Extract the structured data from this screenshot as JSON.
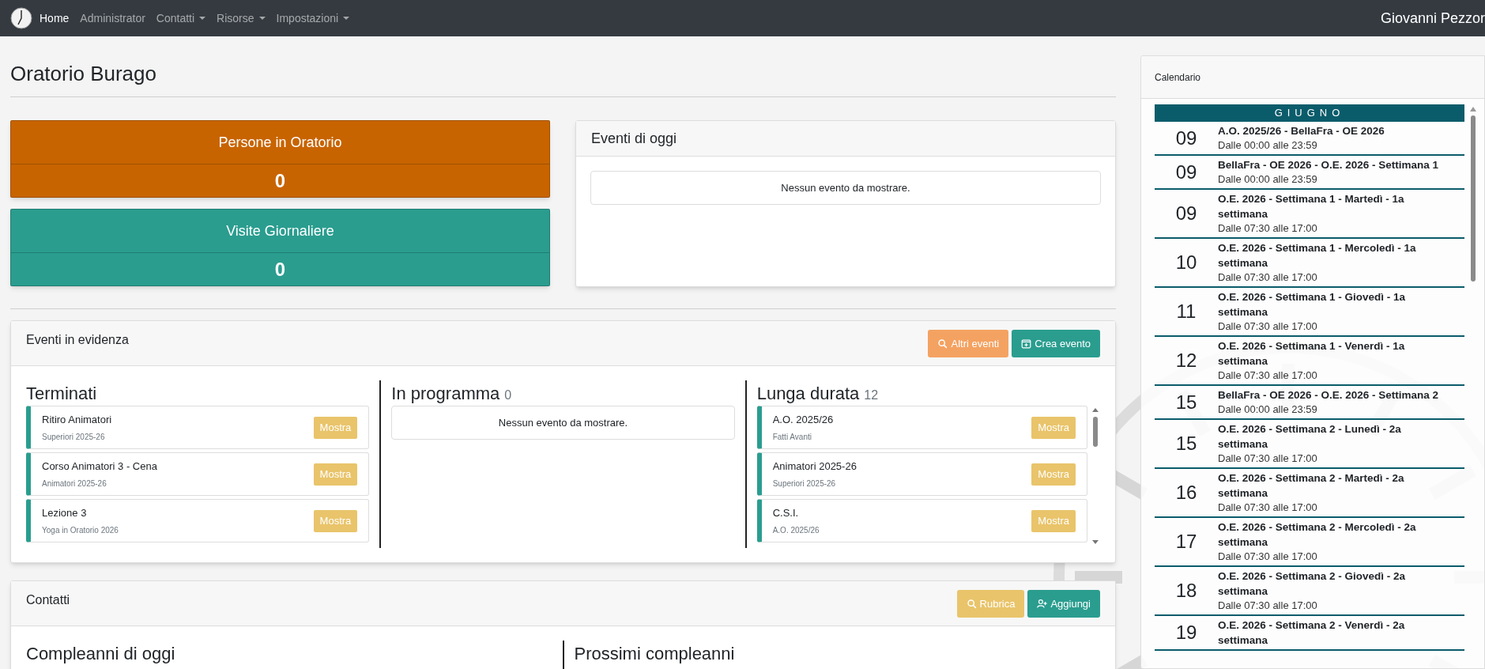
{
  "navbar": {
    "items": [
      {
        "label": "Home",
        "selected": true,
        "dropdown": false
      },
      {
        "label": "Administrator",
        "selected": false,
        "dropdown": false
      },
      {
        "label": "Contatti",
        "selected": false,
        "dropdown": true
      },
      {
        "label": "Risorse",
        "selected": false,
        "dropdown": true
      },
      {
        "label": "Impostazioni",
        "selected": false,
        "dropdown": true
      }
    ],
    "user": "Giovanni Pezzor"
  },
  "page_title": "Oratorio Burago",
  "stats": [
    {
      "label": "Persone in Oratorio",
      "value": "0",
      "color": "#c86400"
    },
    {
      "label": "Visite Giornaliere",
      "value": "0",
      "color": "#2a9d8f"
    }
  ],
  "today_events": {
    "title": "Eventi di oggi",
    "empty_message": "Nessun evento da mostrare."
  },
  "featured": {
    "title": "Eventi in evidenza",
    "buttons": [
      {
        "label": "Altri eventi",
        "kind": "search"
      },
      {
        "label": "Crea evento",
        "kind": "create"
      }
    ],
    "columns": [
      {
        "title": "Terminati",
        "items": [
          {
            "title": "Ritiro Animatori",
            "subtitle": "Superiori 2025-26",
            "button": "Mostra"
          },
          {
            "title": "Corso Animatori 3 - Cena",
            "subtitle": "Animatori 2025-26",
            "button": "Mostra"
          },
          {
            "title": "Lezione 3",
            "subtitle": "Yoga in Oratorio 2026",
            "button": "Mostra"
          }
        ]
      },
      {
        "title": "In programma",
        "count": "0",
        "empty_message": "Nessun evento da mostrare."
      },
      {
        "title": "Lunga durata",
        "count": "12",
        "scrollable": true,
        "items": [
          {
            "title": "A.O. 2025/26",
            "subtitle": "Fatti Avanti",
            "button": "Mostra"
          },
          {
            "title": "Animatori 2025-26",
            "subtitle": "Superiori 2025-26",
            "button": "Mostra"
          },
          {
            "title": "C.S.I.",
            "subtitle": "A.O. 2025/26",
            "button": "Mostra"
          }
        ]
      }
    ]
  },
  "contacts": {
    "title": "Contatti",
    "buttons": [
      {
        "label": "Rubrica",
        "kind": "search"
      },
      {
        "label": "Aggiungi",
        "kind": "add-person"
      }
    ],
    "columns": [
      {
        "title": "Compleanni di oggi"
      },
      {
        "title": "Prossimi compleanni"
      }
    ]
  },
  "calendar": {
    "title": "Calendario",
    "month": "GIUGNO",
    "entries": [
      {
        "day": "09",
        "title": "A.O. 2025/26 - BellaFra - OE 2026",
        "time": "Dalle 00:00 alle 23:59"
      },
      {
        "day": "09",
        "title": "BellaFra - OE 2026 - O.E. 2026 - Settimana 1",
        "time": "Dalle 00:00 alle 23:59"
      },
      {
        "day": "09",
        "title": "O.E. 2026 - Settimana 1 - Martedì - 1a settimana",
        "time": "Dalle 07:30 alle 17:00"
      },
      {
        "day": "10",
        "title": "O.E. 2026 - Settimana 1 - Mercoledì - 1a settimana",
        "time": "Dalle 07:30 alle 17:00"
      },
      {
        "day": "11",
        "title": "O.E. 2026 - Settimana 1 - Giovedì - 1a settimana",
        "time": "Dalle 07:30 alle 17:00"
      },
      {
        "day": "12",
        "title": "O.E. 2026 - Settimana 1 - Venerdì - 1a settimana",
        "time": "Dalle 07:30 alle 17:00"
      },
      {
        "day": "15",
        "title": "BellaFra - OE 2026 - O.E. 2026 - Settimana 2",
        "time": "Dalle 00:00 alle 23:59"
      },
      {
        "day": "15",
        "title": "O.E. 2026 - Settimana 2 - Lunedì - 2a settimana",
        "time": "Dalle 07:30 alle 17:00"
      },
      {
        "day": "16",
        "title": "O.E. 2026 - Settimana 2 - Martedì - 2a settimana",
        "time": "Dalle 07:30 alle 17:00"
      },
      {
        "day": "17",
        "title": "O.E. 2026 - Settimana 2 - Mercoledì - 2a settimana",
        "time": "Dalle 07:30 alle 17:00"
      },
      {
        "day": "18",
        "title": "O.E. 2026 - Settimana 2 - Giovedì - 2a settimana",
        "time": "Dalle 07:30 alle 17:00"
      },
      {
        "day": "19",
        "title": "O.E. 2026 - Settimana 2 - Venerdì - 2a settimana"
      }
    ]
  }
}
